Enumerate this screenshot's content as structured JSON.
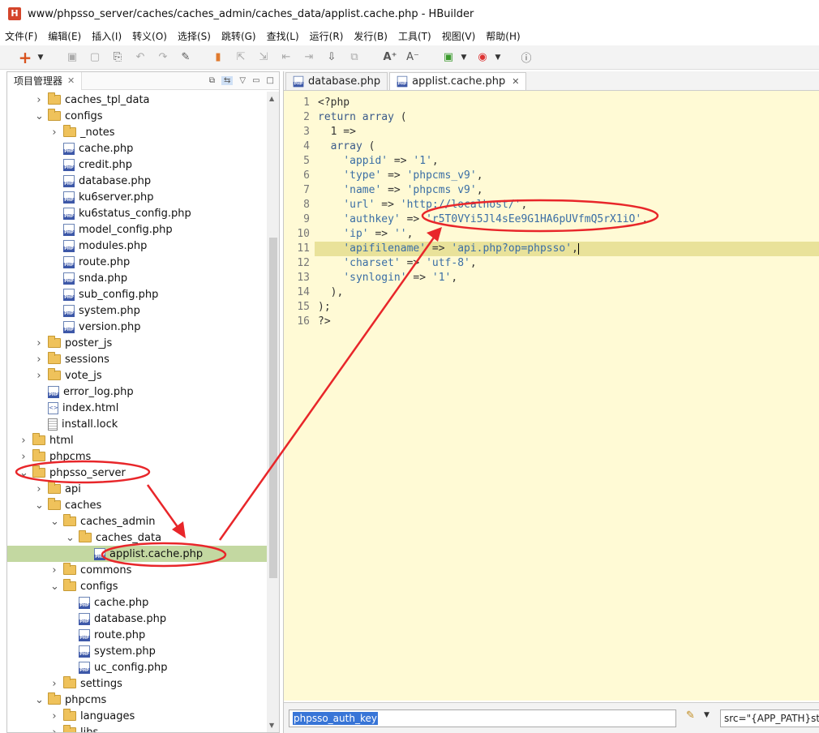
{
  "window": {
    "title": "www/phpsso_server/caches/caches_admin/caches_data/applist.cache.php  -  HBuilder",
    "logo": "H"
  },
  "menu": [
    "文件(F)",
    "编辑(E)",
    "插入(I)",
    "转义(O)",
    "选择(S)",
    "跳转(G)",
    "查找(L)",
    "运行(R)",
    "发行(B)",
    "工具(T)",
    "视图(V)",
    "帮助(H)"
  ],
  "left_panel": {
    "tab_label": "项目管理器"
  },
  "tree": [
    {
      "label": "caches_tpl_data",
      "indent": 2,
      "type": "folder",
      "arrow": "›"
    },
    {
      "label": "configs",
      "indent": 2,
      "type": "folder",
      "arrow": "⌄"
    },
    {
      "label": "_notes",
      "indent": 3,
      "type": "folder",
      "arrow": "›"
    },
    {
      "label": "cache.php",
      "indent": 3,
      "type": "php"
    },
    {
      "label": "credit.php",
      "indent": 3,
      "type": "php"
    },
    {
      "label": "database.php",
      "indent": 3,
      "type": "php"
    },
    {
      "label": "ku6server.php",
      "indent": 3,
      "type": "php"
    },
    {
      "label": "ku6status_config.php",
      "indent": 3,
      "type": "php"
    },
    {
      "label": "model_config.php",
      "indent": 3,
      "type": "php"
    },
    {
      "label": "modules.php",
      "indent": 3,
      "type": "php"
    },
    {
      "label": "route.php",
      "indent": 3,
      "type": "php"
    },
    {
      "label": "snda.php",
      "indent": 3,
      "type": "php"
    },
    {
      "label": "sub_config.php",
      "indent": 3,
      "type": "php"
    },
    {
      "label": "system.php",
      "indent": 3,
      "type": "php"
    },
    {
      "label": "version.php",
      "indent": 3,
      "type": "php"
    },
    {
      "label": "poster_js",
      "indent": 2,
      "type": "folder",
      "arrow": "›"
    },
    {
      "label": "sessions",
      "indent": 2,
      "type": "folder",
      "arrow": "›"
    },
    {
      "label": "vote_js",
      "indent": 2,
      "type": "folder",
      "arrow": "›"
    },
    {
      "label": "error_log.php",
      "indent": 2,
      "type": "php"
    },
    {
      "label": "index.html",
      "indent": 2,
      "type": "html"
    },
    {
      "label": "install.lock",
      "indent": 2,
      "type": "lock"
    },
    {
      "label": "html",
      "indent": 1,
      "type": "folder",
      "arrow": "›"
    },
    {
      "label": "phpcms",
      "indent": 1,
      "type": "folder",
      "arrow": "›"
    },
    {
      "label": "phpsso_server",
      "indent": 1,
      "type": "folder",
      "arrow": "⌄"
    },
    {
      "label": "api",
      "indent": 2,
      "type": "folder",
      "arrow": "›"
    },
    {
      "label": "caches",
      "indent": 2,
      "type": "folder",
      "arrow": "⌄"
    },
    {
      "label": "caches_admin",
      "indent": 3,
      "type": "folder",
      "arrow": "⌄"
    },
    {
      "label": "caches_data",
      "indent": 4,
      "type": "folder",
      "arrow": "⌄"
    },
    {
      "label": "applist.cache.php",
      "indent": 5,
      "type": "php",
      "selected": true
    },
    {
      "label": "commons",
      "indent": 3,
      "type": "folder",
      "arrow": "›"
    },
    {
      "label": "configs",
      "indent": 3,
      "type": "folder",
      "arrow": "⌄"
    },
    {
      "label": "cache.php",
      "indent": 4,
      "type": "php"
    },
    {
      "label": "database.php",
      "indent": 4,
      "type": "php"
    },
    {
      "label": "route.php",
      "indent": 4,
      "type": "php"
    },
    {
      "label": "system.php",
      "indent": 4,
      "type": "php"
    },
    {
      "label": "uc_config.php",
      "indent": 4,
      "type": "php"
    },
    {
      "label": "settings",
      "indent": 3,
      "type": "folder",
      "arrow": "›"
    },
    {
      "label": "phpcms",
      "indent": 2,
      "type": "folder",
      "arrow": "⌄"
    },
    {
      "label": "languages",
      "indent": 3,
      "type": "folder",
      "arrow": "›"
    },
    {
      "label": "libs",
      "indent": 3,
      "type": "folder",
      "arrow": "›"
    }
  ],
  "editor": {
    "tabs": [
      {
        "label": "database.php",
        "active": false
      },
      {
        "label": "applist.cache.php",
        "active": true
      }
    ],
    "highlighted_line": 11,
    "code_lines": [
      "<?php",
      "return array (",
      "  1 =>",
      "  array (",
      "    'appid' => '1',",
      "    'type' => 'phpcms_v9',",
      "    'name' => 'phpcms v9',",
      "    'url' => 'http://localhost/',",
      "    'authkey' => 'r5T0VYi5Jl4sEe9G1HA6pUVfmQ5rX1iO',",
      "    'ip' => '',",
      "    'apifilename' => 'api.php?op=phpsso',",
      "    'charset' => 'utf-8',",
      "    'synlogin' => '1',",
      "  ),",
      ");",
      "?>"
    ]
  },
  "find_bar": {
    "value": "phpsso_auth_key",
    "src_value": "src=\"{APP_PATH}stat"
  },
  "colors": {
    "annotation": "#e8262a",
    "selection": "#c3d8a1",
    "editor_bg": "#fffad5",
    "current_line": "#e9e29a"
  }
}
